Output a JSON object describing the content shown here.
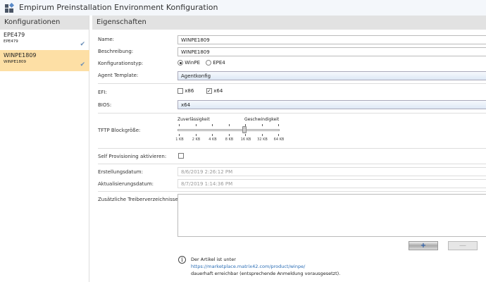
{
  "window": {
    "title": "Empirum Preinstallation Environment Konfiguration"
  },
  "left": {
    "header": "Konfigurationen",
    "items": [
      {
        "name": "EPE479",
        "sub": "EPE479",
        "selected": false
      },
      {
        "name": "WINPE1809",
        "sub": "WINPE1809",
        "selected": true
      }
    ]
  },
  "right": {
    "header": "Eigenschaften",
    "name_label": "Name:",
    "name_value": "WINPE1809",
    "desc_label": "Beschreibung:",
    "desc_value": "WINPE1809",
    "type_label": "Konfigurationstyp:",
    "type_options": [
      "WinPE",
      "EPE4"
    ],
    "type_selected": "WinPE",
    "agent_label": "Agent Template:",
    "agent_value": "Agentkonfig",
    "efi_label": "EFI:",
    "efi_x86": "x86",
    "efi_x86_checked": false,
    "efi_x64": "x64",
    "efi_x64_checked": true,
    "bios_label": "BIOS:",
    "bios_value": "x64",
    "tftp_label": "TFTP Blockgröße:",
    "slider_left": "Zuverlässigkeit",
    "slider_right": "Geschwindigkeit",
    "slider_ticks": [
      "1 KB",
      "2 KB",
      "4 KB",
      "8 KB",
      "16 KB",
      "32 KB",
      "64 KB"
    ],
    "slider_value": "16 KB",
    "selfprov_label": "Self Provisioning aktivieren:",
    "selfprov_checked": false,
    "created_label": "Erstellungsdatum:",
    "created_value": "8/6/2019 2:26:12 PM",
    "updated_label": "Aktualisierungsdatum:",
    "updated_value": "8/7/2019 1:14:36 PM",
    "drivers_label": "Zusätzliche Treiberverzeichnisse:",
    "drivers_value": "",
    "add_button": "+",
    "remove_button": "—",
    "info_line1": "Der Artikel ist unter",
    "info_link": "https://marketplace.matrix42.com/product/winpe/",
    "info_line3": "dauerhaft erreichbar (entsprechende Anmeldung vorausgesetzt)."
  }
}
